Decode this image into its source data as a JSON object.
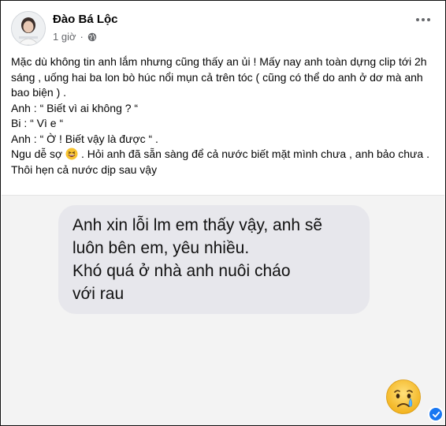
{
  "post": {
    "author": "Đào Bá Lộc",
    "time": "1 giờ",
    "separator": "·",
    "privacy_icon": "globe-icon",
    "more_icon": "more-dots-icon",
    "paragraphs": {
      "p1": "Mặc dù không tin anh lắm nhưng cũng thấy an ủi ! Mấy nay anh toàn dựng clip tới 2h sáng , uống hai ba lon bò húc nổi mụn cả trên tóc ( cũng có thể do anh ở dơ mà anh bao biện ) .",
      "p2": "Anh : “ Biết vì ai không ? “",
      "p3": "Bi : “ Vì e “",
      "p4": "Anh : “ Ờ ! Biết vậy là được “ .",
      "p5_before": "Ngu dễ sợ ",
      "p5_emoji": "grinning-squinting-face-emoji",
      "p5_after": " . Hỏi anh đã sẵn sàng để cả nước biết mặt mình chưa , anh bảo chưa . Thôi hẹn cả nước dịp sau vậy"
    }
  },
  "photo": {
    "message_lines": {
      "l1": "Anh xin lỗi lm em thấy vậy, anh sẽ",
      "l2": "luôn bên em, yêu nhiều.",
      "l3": "Khó quá ở nhà anh nuôi cháo",
      "l4": "với rau"
    },
    "reaction_emoji": "crying-face-emoji",
    "badge_icon": "verified-check-icon"
  },
  "colors": {
    "text": "#050505",
    "meta": "#65676b",
    "bubble": "#e7e7ec",
    "photo_bg": "#f3f3f3",
    "badge": "#1877f2"
  }
}
